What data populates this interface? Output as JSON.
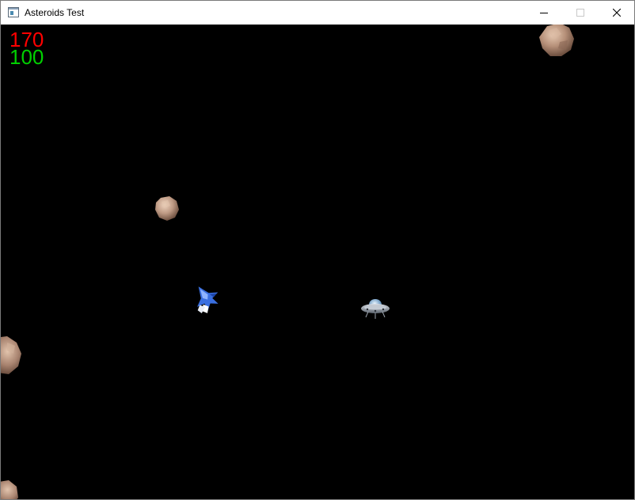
{
  "window": {
    "title": "Asteroids Test",
    "icons": {
      "app": "app-window-icon",
      "minimize": "minimize-icon",
      "maximize": "maximize-icon",
      "close": "close-icon"
    }
  },
  "hud": {
    "score": "170",
    "health": "100",
    "score_color": "#ff0000",
    "health_color": "#00d000"
  },
  "game": {
    "background": "#000000",
    "sprites": [
      "asteroid",
      "asteroid",
      "asteroid",
      "asteroid",
      "player-ship",
      "ufo"
    ]
  }
}
